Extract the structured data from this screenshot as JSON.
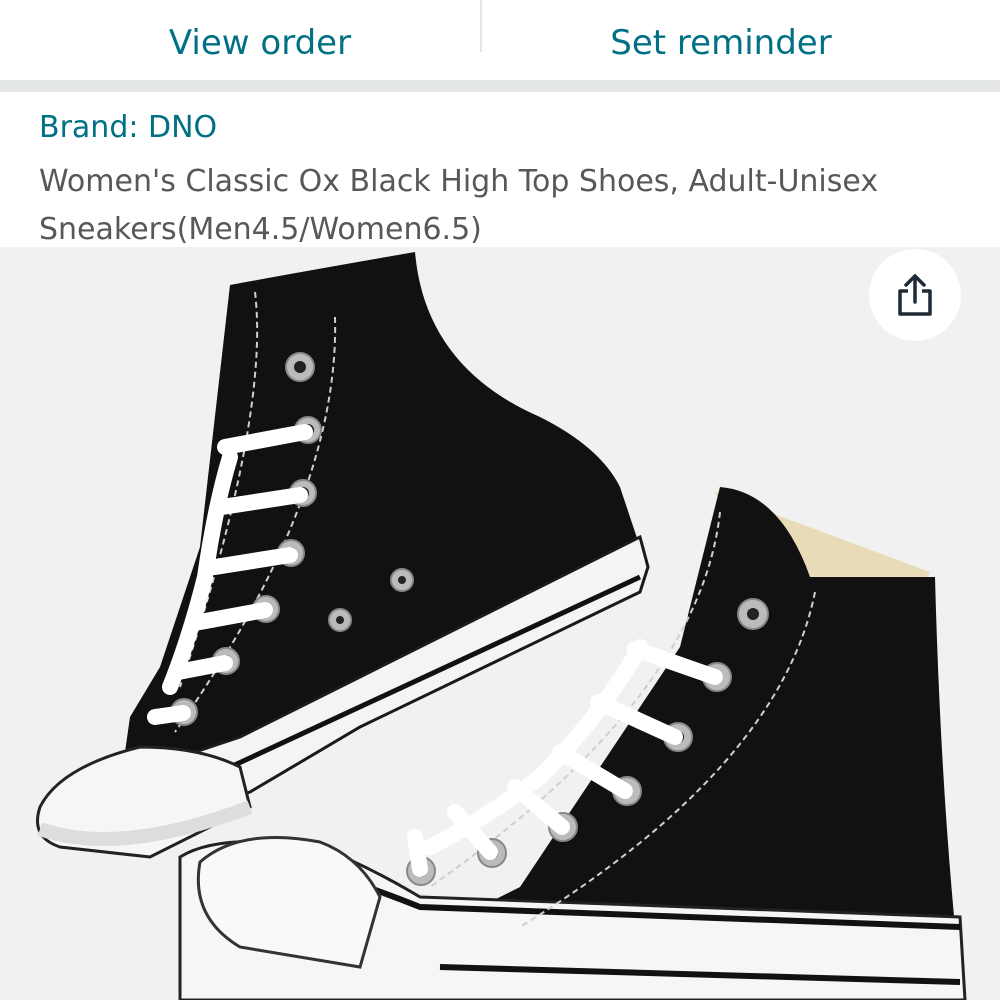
{
  "actions": {
    "view_order": "View order",
    "set_reminder": "Set reminder"
  },
  "product": {
    "brand": "Brand: DNO",
    "title": "Women's Classic Ox Black High Top Shoes, Adult-Unisex Sneakers(Men4.5/Women6.5)"
  },
  "image": {
    "subject": "black-high-top-canvas-sneakers-pair"
  },
  "icons": {
    "share": "share-icon"
  },
  "colors": {
    "link": "#007185",
    "text_secondary": "#565959",
    "divider": "#e3e6e6",
    "image_background": "#f1f1f1"
  }
}
